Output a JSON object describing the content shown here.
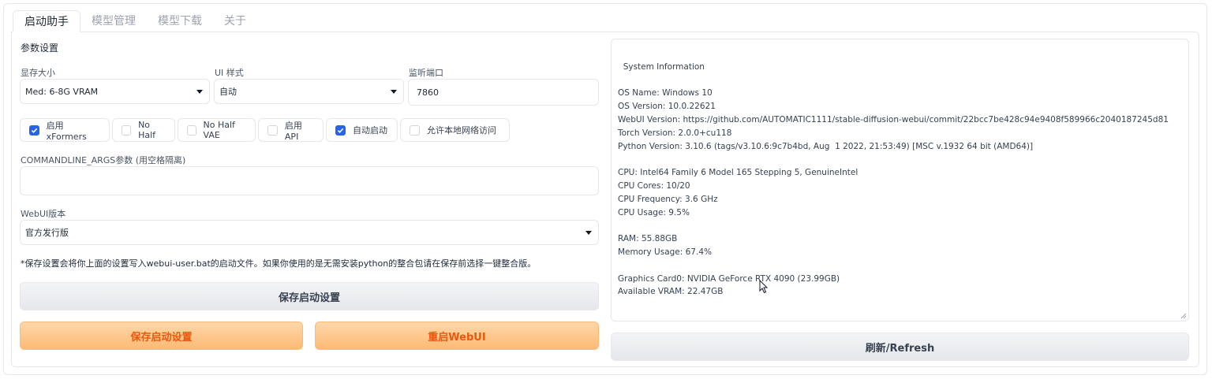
{
  "tabs": [
    {
      "label": "启动助手",
      "active": true
    },
    {
      "label": "模型管理",
      "active": false
    },
    {
      "label": "模型下载",
      "active": false
    },
    {
      "label": "关于",
      "active": false
    }
  ],
  "settings": {
    "section_title": "参数设置",
    "vram": {
      "label": "显存大小",
      "value": "Med: 6-8G VRAM"
    },
    "ui_style": {
      "label": "UI 样式",
      "value": "自动"
    },
    "port": {
      "label": "监听端口",
      "value": "7860"
    },
    "checkboxes": [
      {
        "label": "启用xFormers",
        "checked": true
      },
      {
        "label": "No Half",
        "checked": false
      },
      {
        "label": "No Half VAE",
        "checked": false
      },
      {
        "label": "启用API",
        "checked": false
      },
      {
        "label": "自动启动",
        "checked": true
      },
      {
        "label": "允许本地网络访问",
        "checked": false
      }
    ],
    "cmdline": {
      "label": "COMMANDLINE_ARGS参数 (用空格隔离)",
      "value": ""
    },
    "webui_version": {
      "label": "WebUI版本",
      "value": "官方发行版"
    },
    "note": "*保存设置会将你上面的设置写入webui-user.bat的启动文件。如果你使用的是无需安装python的整合包请在保存前选择一键整合版。"
  },
  "buttons": {
    "save_settings_grey": "保存启动设置",
    "save_settings": "保存启动设置",
    "restart": "重启WebUI",
    "refresh": "刷新/Refresh"
  },
  "system_info": {
    "text": "System Information\n\nOS Name: Windows 10\nOS Version: 10.0.22621\nWebUI Version: https://github.com/AUTOMATIC1111/stable-diffusion-webui/commit/22bcc7be428c94e9408f589966c2040187245d81\nTorch Version: 2.0.0+cu118\nPython Version: 3.10.6 (tags/v3.10.6:9c7b4bd, Aug  1 2022, 21:53:49) [MSC v.1932 64 bit (AMD64)]\n\nCPU: Intel64 Family 6 Model 165 Stepping 5, GenuineIntel\nCPU Cores: 10/20\nCPU Frequency: 3.6 GHz\nCPU Usage: 9.5%\n\nRAM: 55.88GB\nMemory Usage: 67.4%\n\nGraphics Card0: NVIDIA GeForce RTX 4090 (23.99GB)\nAvailable VRAM: 22.47GB"
  },
  "colors": {
    "accent": "#2563eb",
    "orange_text": "#ea580c",
    "orange_fill": "#fdba74"
  }
}
